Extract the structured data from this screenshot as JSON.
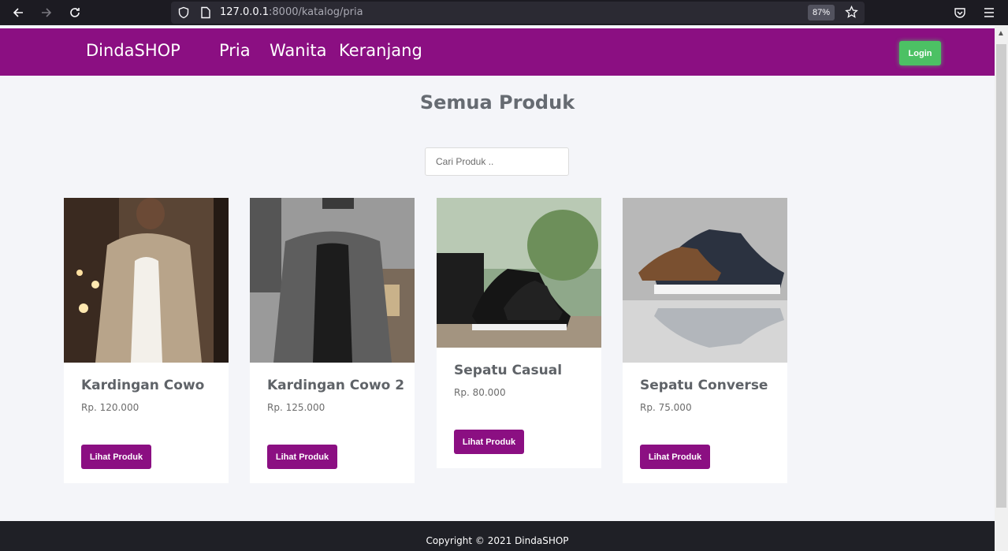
{
  "browser": {
    "url_host": "127.0.0.1",
    "url_rest": ":8000/katalog/pria",
    "zoom": "87%"
  },
  "navbar": {
    "brand": "DindaSHOP",
    "links": [
      "Pria",
      "Wanita",
      "Keranjang"
    ],
    "login_label": "Login"
  },
  "main": {
    "title": "Semua Produk",
    "search_placeholder": "Cari Produk .."
  },
  "products": [
    {
      "name": "Kardingan Cowo",
      "price": "Rp. 120.000",
      "button": "Lihat Produk"
    },
    {
      "name": "Kardingan Cowo 2",
      "price": "Rp. 125.000",
      "button": "Lihat Produk"
    },
    {
      "name": "Sepatu Casual",
      "price": "Rp. 80.000",
      "button": "Lihat Produk"
    },
    {
      "name": "Sepatu Converse",
      "price": "Rp. 75.000",
      "button": "Lihat Produk"
    }
  ],
  "footer": {
    "text": "Copyright © 2021 DindaSHOP"
  },
  "colors": {
    "brand_purple": "#8b0f82",
    "login_green": "#4cc164",
    "footer_dark": "#1f2026"
  }
}
